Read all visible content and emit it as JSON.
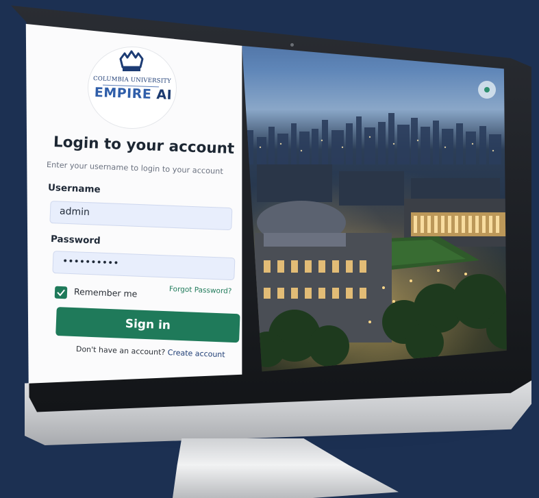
{
  "logo": {
    "top_text": "COLUMBIA UNIVERSITY",
    "main_text": "EMPIRE",
    "main_text_suffix": "AI"
  },
  "login": {
    "title": "Login to your account",
    "subtitle": "Enter your username to login to your account",
    "username_label": "Username",
    "username_value": "admin",
    "password_label": "Password",
    "password_value": "••••••••••",
    "remember_label": "Remember me",
    "remember_checked": true,
    "forgot_label": "Forgot Password?",
    "signin_label": "Sign in",
    "no_account_text": "Don't have an account?",
    "create_account_label": "Create account"
  },
  "colors": {
    "background": "#1c3052",
    "primary_green": "#1f7a5a",
    "input_bg": "#e8eefc",
    "logo_blue": "#2f5ea9"
  },
  "icons": {
    "logo": "crown-icon",
    "checkbox": "check-icon",
    "theme": "theme-toggle-icon"
  }
}
